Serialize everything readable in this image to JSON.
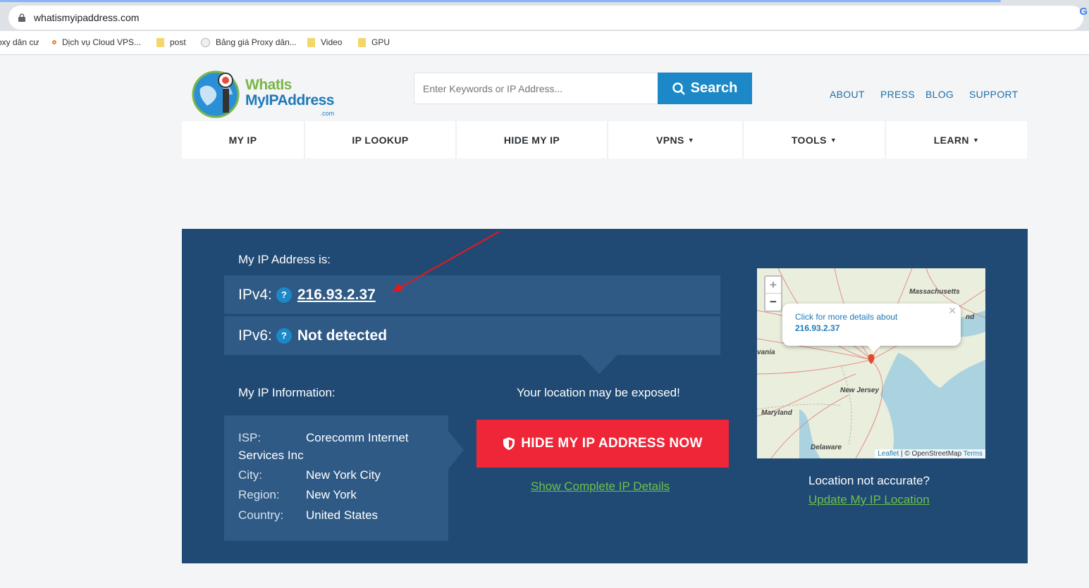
{
  "browser": {
    "url": "whatismyipaddress.com",
    "bookmarks": [
      {
        "label": "oxy dân cư",
        "icon": "none"
      },
      {
        "label": "Dịch vụ Cloud VPS...",
        "icon": "orange-dot-icon"
      },
      {
        "label": "post",
        "icon": "folder-icon"
      },
      {
        "label": "Bảng giá Proxy dân...",
        "icon": "site-icon"
      },
      {
        "label": "Video",
        "icon": "folder-icon"
      },
      {
        "label": "GPU",
        "icon": "folder-icon"
      }
    ]
  },
  "header": {
    "logo": {
      "line1": "WhatIs",
      "line2": "MyIPAddress",
      "line3": ".com"
    },
    "search_placeholder": "Enter Keywords or IP Address...",
    "search_label": "Search",
    "links": [
      "ABOUT",
      "PRESS",
      "BLOG",
      "SUPPORT"
    ]
  },
  "nav": [
    {
      "label": "MY IP",
      "dropdown": false
    },
    {
      "label": "IP LOOKUP",
      "dropdown": false
    },
    {
      "label": "HIDE MY IP",
      "dropdown": false
    },
    {
      "label": "VPNS",
      "dropdown": true
    },
    {
      "label": "TOOLS",
      "dropdown": true
    },
    {
      "label": "LEARN",
      "dropdown": true
    }
  ],
  "main": {
    "ip_heading": "My IP Address is:",
    "ipv4_label": "IPv4:",
    "ipv4_value": "216.93.2.37",
    "ipv6_label": "IPv6:",
    "ipv6_value": "Not detected",
    "info_heading": "My IP Information:",
    "info": {
      "isp_key": "ISP:",
      "isp_val": "Corecomm Internet",
      "isp_val2": "Services Inc",
      "city_key": "City:",
      "city_val": "New York City",
      "region_key": "Region:",
      "region_val": "New York",
      "country_key": "Country:",
      "country_val": "United States"
    },
    "exposed_text": "Your location may be exposed!",
    "hide_button": "HIDE MY IP ADDRESS NOW",
    "details_link": "Show Complete IP Details",
    "location_question": "Location not accurate?",
    "update_link": "Update My IP Location"
  },
  "map": {
    "popup_text": "Click for more details about",
    "popup_ip": "216.93.2.37",
    "labels": {
      "massachusetts": "Massachusetts",
      "nd": "nd",
      "vania": "vania",
      "new_jersey": "New Jersey",
      "maryland": "Maryland",
      "delaware": "Delaware"
    },
    "attr_leaflet": "Leaflet",
    "attr_osm": "| © OpenStreetMap",
    "attr_terms": "Terms"
  },
  "colors": {
    "panel": "#204a74",
    "accent_blue": "#1c88c7",
    "hide_red": "#ef2637",
    "link_green": "#6cc04a"
  }
}
